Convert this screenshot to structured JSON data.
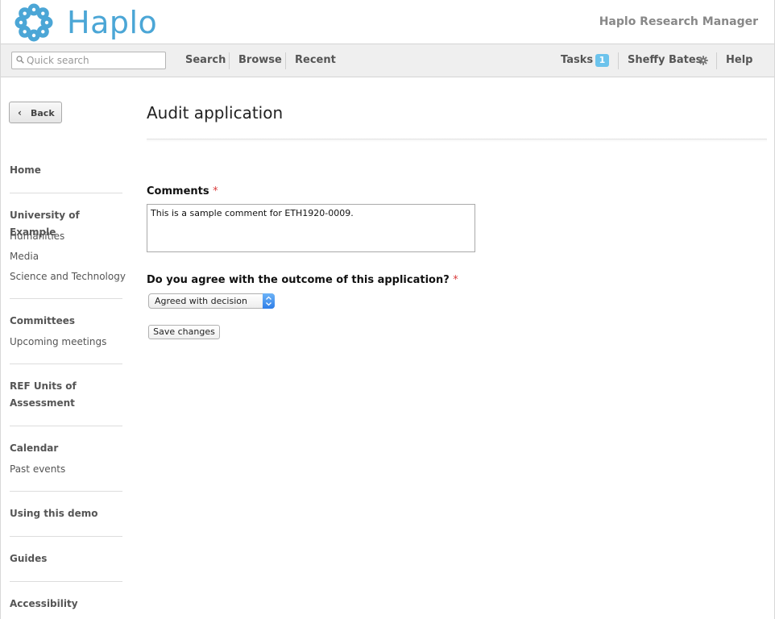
{
  "header": {
    "logo_text": "Haplo",
    "app_name": "Haplo Research Manager",
    "logo_color": "#4ba6d6"
  },
  "nav": {
    "search_placeholder": "Quick search",
    "search": "Search",
    "browse": "Browse",
    "recent": "Recent",
    "tasks": "Tasks",
    "tasks_count": "1",
    "user": "Sheffy Bates",
    "help": "Help",
    "badge_color": "#6cc3ec"
  },
  "sidebar": {
    "back_label": "Back",
    "home": "Home",
    "university": "University of Example",
    "humanities": "Humanities",
    "media": "Media",
    "science": "Science and Technology",
    "committees": "Committees",
    "upcoming": "Upcoming meetings",
    "ref_units": "REF Units of Assessment",
    "calendar": "Calendar",
    "past_events": "Past events",
    "using_demo": "Using this demo",
    "guides": "Guides",
    "accessibility": "Accessibility"
  },
  "main": {
    "title": "Audit application",
    "comments_label": "Comments",
    "required_mark": "*",
    "comment_value": "This is a sample comment for ETH1920-0009.",
    "agree_label": "Do you agree with the outcome of this application?",
    "agree_selected": "Agreed with decision",
    "save_label": "Save changes"
  }
}
